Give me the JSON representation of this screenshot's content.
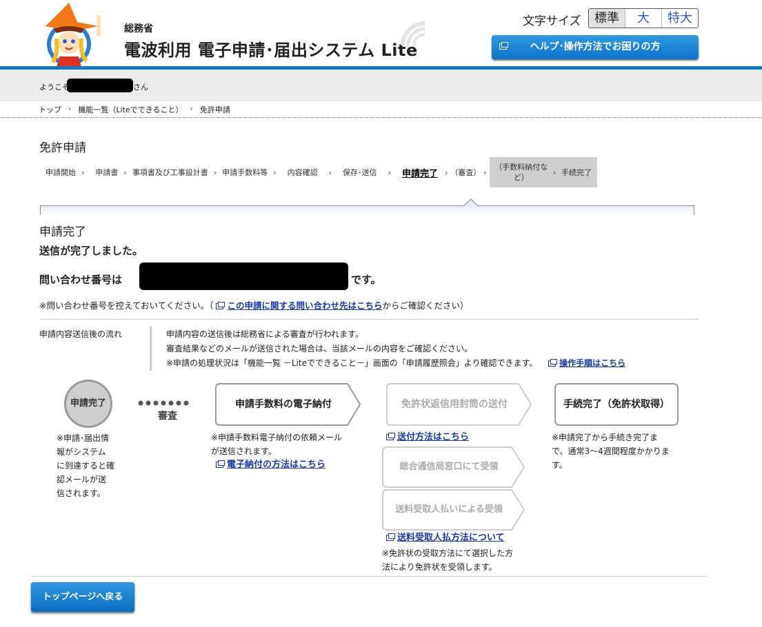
{
  "header": {
    "ministry": "総務省",
    "system_name": "電波利用 電子申請･届出システム Lite",
    "font_size_label": "文字サイズ",
    "font_sizes": [
      "標準",
      "大",
      "特大"
    ],
    "help_button": "ヘルプ･操作方法でお困りの方"
  },
  "welcome": {
    "prefix": "ようこそ",
    "suffix": "さん"
  },
  "breadcrumb": [
    "トップ",
    "機能一覧（Liteでできること）",
    "免許申請"
  ],
  "page_title": "免許申請",
  "steps": {
    "items": [
      "申請開始",
      "申請書",
      "事項書及び工事設計書",
      "申請手数料等",
      "内容確認",
      "保存･送信"
    ],
    "current": "申請完了",
    "review": "（審査）",
    "fee_payment": "（手数料納付など）",
    "complete": "手続完了"
  },
  "main": {
    "heading": "申請完了",
    "sent_message": "送信が完了しました。",
    "inquiry_label": "問い合わせ番号は",
    "inquiry_suffix": "です。",
    "note_prefix": "※問い合わせ番号を控えておいてください。（",
    "note_link": "この申請に関する問い合わせ先はこちら",
    "note_suffix": "からご確認ください）"
  },
  "flow": {
    "label": "申請内容送信後の流れ",
    "line1": "申請内容の送信後は総務省による審査が行われます。",
    "line2": "審査結果などのメールが送信された場合は、当該メールの内容をご確認ください。",
    "line3": "※申請の処理状況は「機能一覧 －Liteでできること－」画面の「申請履歴照会」より確認できます。",
    "line3_link": "操作手順はこちら"
  },
  "diagram": {
    "circle": "申請完了",
    "review": "審査",
    "note_circle": [
      "※申請･届出情",
      "報がシステム",
      "に到達すると確",
      "認メールが送",
      "信されます。"
    ],
    "fee_box": "申請手数料の電子納付",
    "fee_note": [
      "※申請手数料電子納付の依頼メール",
      "が送信されます。"
    ],
    "fee_link": "電子納付の方法はこちら",
    "envelope_box": "免許状返信用封筒の送付",
    "envelope_link": "送付方法はこちら",
    "counter_box": "総合通信局窓口にて受領",
    "cod_box": "送料受取人払いによる受領",
    "cod_link": "送料受取人払方法について",
    "receive_note": [
      "※免許状の受取方法にて選択した方",
      "法により免許状を受領します。"
    ],
    "done_box": "手続完了（免許状取得）",
    "done_note": [
      "※申請完了から手続き完了ま",
      "で、通常3～4週間程度かかりま",
      "す。"
    ]
  },
  "footer": {
    "top_button": "トップページへ戻る"
  },
  "colors": {
    "accent": "#0f7ac8",
    "link": "#1a3aa8"
  }
}
